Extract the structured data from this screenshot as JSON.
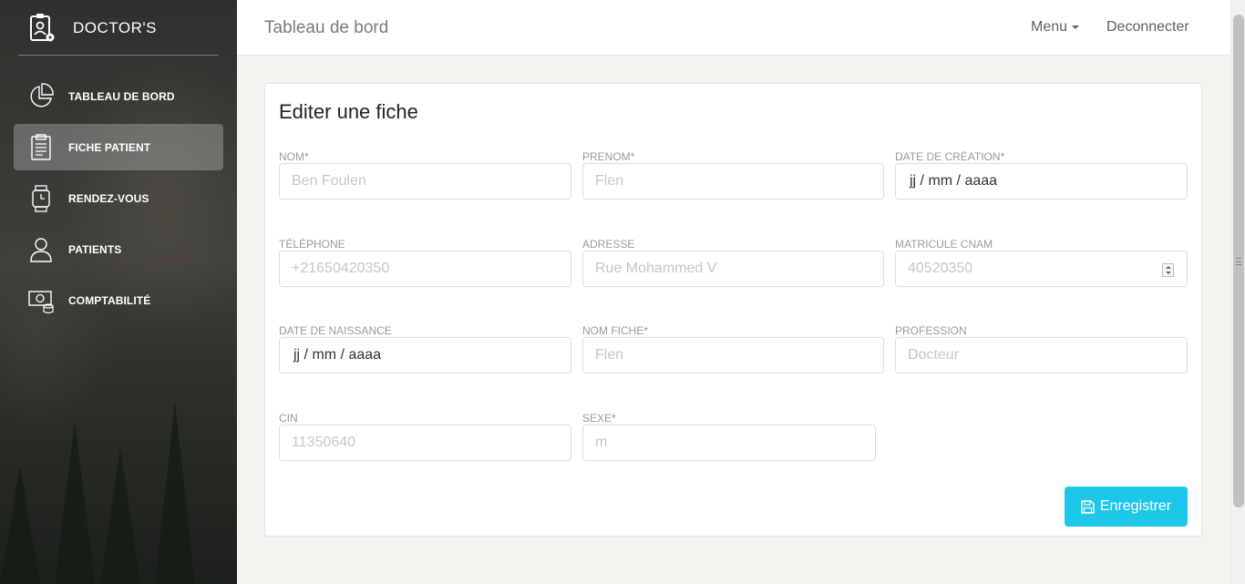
{
  "brand": {
    "name": "DOCTOR'S"
  },
  "sidebar": {
    "items": [
      {
        "label": "TABLEAU DE BORD",
        "icon": "pie-chart-icon",
        "active": false
      },
      {
        "label": "FICHE PATIENT",
        "icon": "clipboard-icon",
        "active": true
      },
      {
        "label": "RENDEZ-VOUS",
        "icon": "watch-icon",
        "active": false
      },
      {
        "label": "PATIENTS",
        "icon": "user-icon",
        "active": false
      },
      {
        "label": "COMPTABILITÉ",
        "icon": "money-icon",
        "active": false
      }
    ]
  },
  "topbar": {
    "title": "Tableau de bord",
    "menu_label": "Menu",
    "logout_label": "Deconnecter"
  },
  "form": {
    "title": "Editer une fiche",
    "fields": {
      "nom": {
        "label": "NOM*",
        "placeholder": "Ben Foulen"
      },
      "prenom": {
        "label": "PRENOM*",
        "placeholder": "Flen"
      },
      "date_creation": {
        "label": "DATE DE CRÉATION*",
        "value": "jj / mm / aaaa"
      },
      "telephone": {
        "label": "TÉLÉPHONE",
        "placeholder": "+21650420350"
      },
      "adresse": {
        "label": "ADRESSE",
        "placeholder": "Rue Mohammed V"
      },
      "matricule": {
        "label": "MATRICULE CNAM",
        "placeholder": "40520350"
      },
      "date_naissance": {
        "label": "DATE DE NAISSANCE",
        "value": "jj / mm / aaaa"
      },
      "nom_fiche": {
        "label": "NOM FICHE*",
        "placeholder": "Flen"
      },
      "profession": {
        "label": "PROFESSION",
        "placeholder": "Docteur"
      },
      "cin": {
        "label": "CIN",
        "placeholder": "11350640"
      },
      "sexe": {
        "label": "SEXE*",
        "placeholder": "m"
      }
    },
    "save_label": "Enregistrer"
  },
  "colors": {
    "accent": "#1dc7ea",
    "sidebar_active": "#9b9b98",
    "label": "#9a9a9a"
  }
}
